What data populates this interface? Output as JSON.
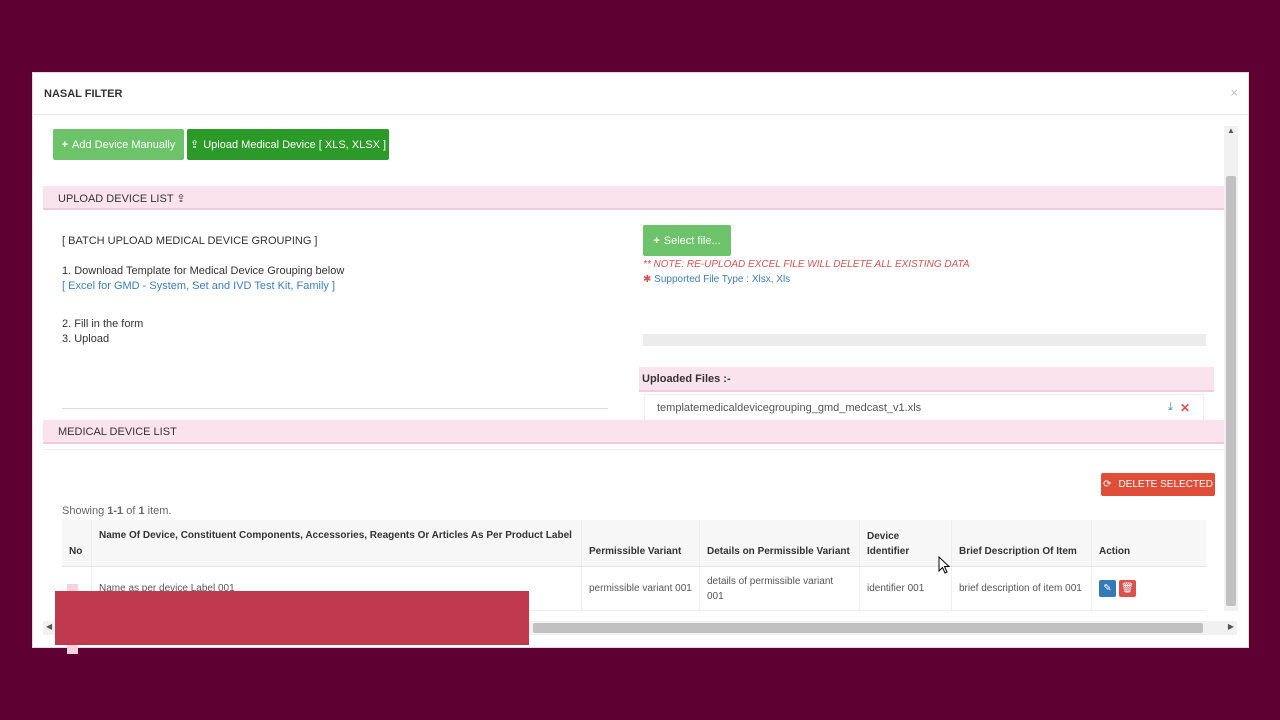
{
  "modal": {
    "title": "NASAL FILTER",
    "close": "×"
  },
  "toolbar": {
    "add_manual": "Add Device Manually",
    "upload_device": "Upload Medical Device [ XLS, XLSX ]"
  },
  "upload_section": {
    "title": "UPLOAD DEVICE LIST",
    "batch_title": "[ BATCH UPLOAD MEDICAL DEVICE GROUPING ]",
    "step1": "1. Download Template for Medical Device Grouping below",
    "template_link": "[ Excel for GMD - System, Set and IVD Test Kit, Family ]",
    "step2": "2. Fill in the form",
    "step3": "3. Upload",
    "select_file": "Select file...",
    "note": "** NOTE: RE-UPLOAD EXCEL FILE WILL DELETE ALL EXISTING DATA",
    "supported": "Supported File Type : Xlsx, Xls",
    "uploaded_header": "Uploaded Files :-",
    "uploaded_file": "templatemedicaldevicegrouping_gmd_medcast_v1.xls"
  },
  "device_list": {
    "title": "MEDICAL DEVICE LIST",
    "delete_selected": "DELETE SELECTED",
    "summary_prefix": "Showing ",
    "summary_range": "1-1",
    "summary_of": " of ",
    "summary_total": "1",
    "summary_suffix": " item.",
    "columns": {
      "no": "No",
      "name": "Name Of Device, Constituent Components, Accessories, Reagents Or Articles As Per Product Label",
      "variant": "Permissible Variant",
      "details": "Details on Permissible Variant",
      "identifier": "Device Identifier",
      "brief": "Brief Description Of Item",
      "action": "Action"
    },
    "rows": [
      {
        "no": "",
        "name": "Name as per device Label 001",
        "variant": "permissible variant 001",
        "details": "details of permissible variant 001",
        "identifier": "identifier 001",
        "brief": "brief description of item 001"
      }
    ]
  },
  "colors": {
    "background": "#5e0032",
    "accent_green": "#6cc36a",
    "dark_green": "#2c9a29",
    "danger": "#e04e3a",
    "section_pink": "#fbe3ee"
  }
}
